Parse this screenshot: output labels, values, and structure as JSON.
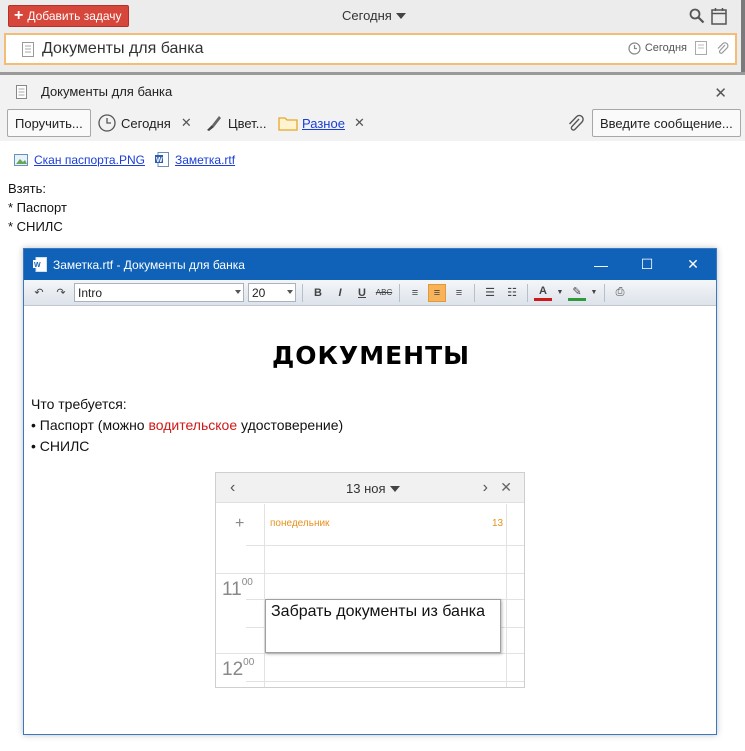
{
  "toolbar": {
    "add_task_label": "Добавить задачу",
    "date_selector": "Сегодня"
  },
  "selected_task": {
    "title": "Документы для банка",
    "date": "Сегодня"
  },
  "detail": {
    "title": "Документы для банка",
    "assign_label": "Поручить...",
    "date_label": "Сегодня",
    "color_label": "Цвет...",
    "folder_label": "Разное",
    "message_label": "Введите сообщение...",
    "attachments": [
      "Скан паспорта.PNG",
      "Заметка.rtf"
    ],
    "notes": [
      "Взять:",
      "* Паспорт",
      "* СНИЛС"
    ]
  },
  "rtf_window": {
    "title": "Заметка.rtf - Документы для банка",
    "font_name": "Intro",
    "font_size": "20",
    "heading": "ДОКУМЕНТЫ",
    "line1": "Что требуется:",
    "line2_pre": "• Паспорт (можно ",
    "line2_red": "водительское",
    "line2_post": " удостоверение)",
    "line3": "• СНИЛС",
    "accent_color": "#0f62b8",
    "highlight_red": "#d01818"
  },
  "calendar": {
    "date": "13 ноя",
    "day_name": "понедельник",
    "day_number": "13",
    "hours": [
      {
        "h": "11",
        "m": "00"
      },
      {
        "h": "12",
        "m": "00"
      }
    ],
    "event": "Забрать документы из банка"
  }
}
